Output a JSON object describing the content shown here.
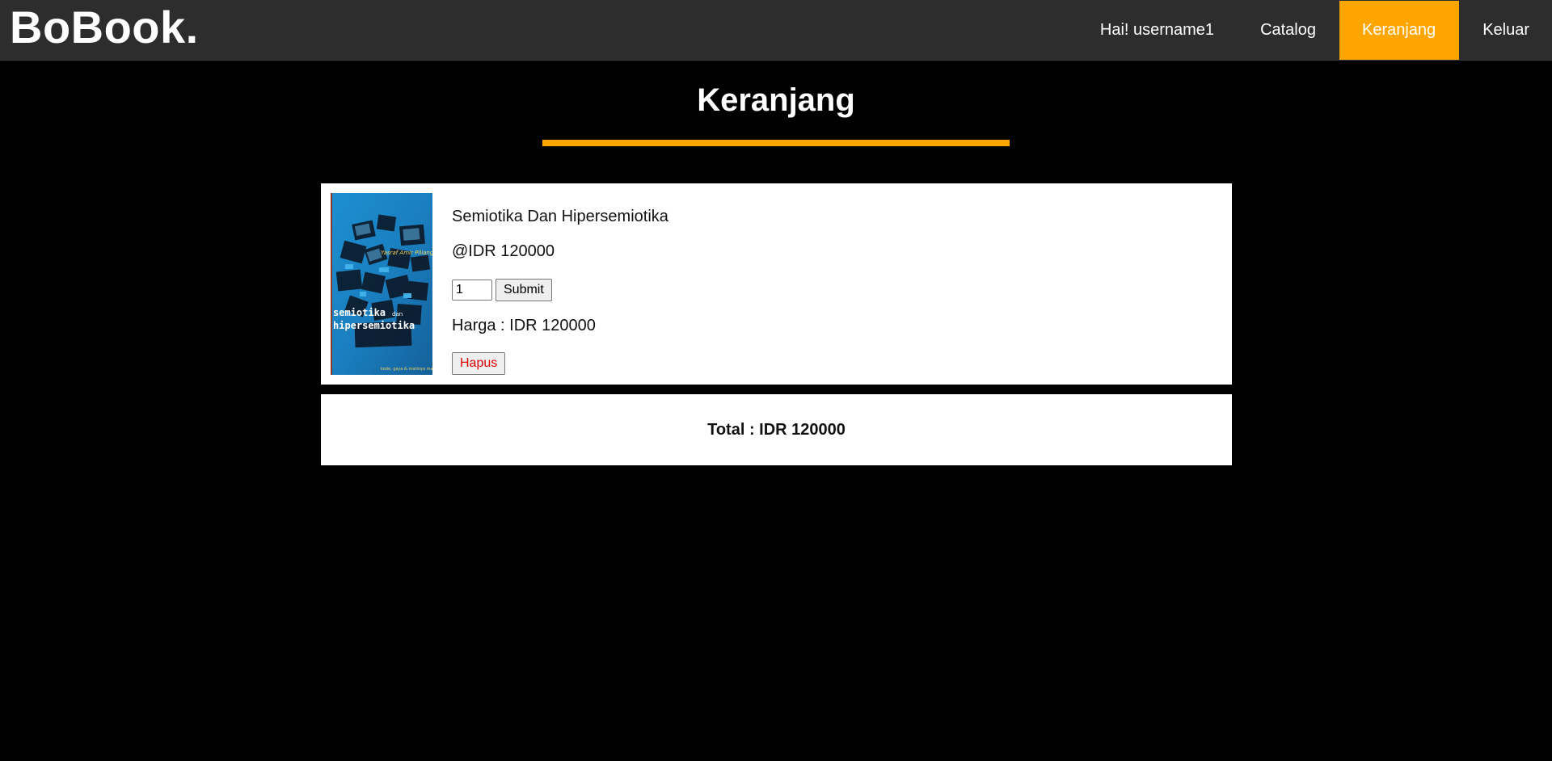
{
  "navbar": {
    "brand": "BoBook.",
    "links": [
      {
        "label": "Hai! username1",
        "active": false
      },
      {
        "label": "Catalog",
        "active": false
      },
      {
        "label": "Keranjang",
        "active": true
      },
      {
        "label": "Keluar",
        "active": false
      }
    ]
  },
  "page": {
    "title": "Keranjang"
  },
  "cart": {
    "items": [
      {
        "title": "Semiotika Dan Hipersemiotika",
        "unit_price": "@IDR 120000",
        "quantity": "1",
        "submit_label": "Submit",
        "subtotal": "Harga : IDR 120000",
        "remove_label": "Hapus",
        "cover": {
          "text_line1": "semiotika",
          "text_line2": "hipersemiotika",
          "author": "Yasraf Amir Piliang"
        }
      }
    ],
    "total": "Total : IDR 120000"
  },
  "colors": {
    "navbar_bg": "#2d2d2d",
    "accent": "#ffa500",
    "page_bg": "#000000",
    "remove_text": "#e00000"
  },
  "icons": {
    "book_cover": "book-cover-image"
  }
}
